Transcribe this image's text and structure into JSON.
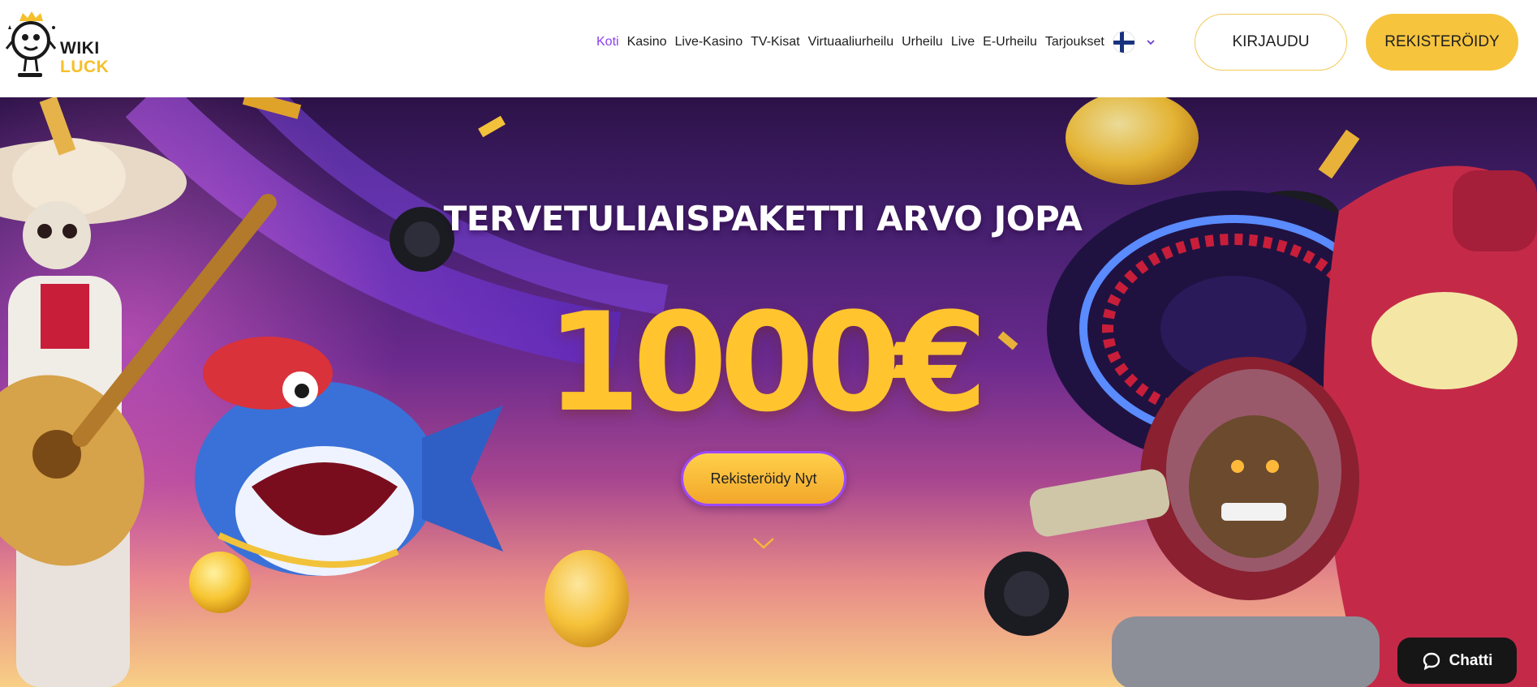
{
  "logo": {
    "line1": "WIKI",
    "line2": "LUCK"
  },
  "nav": {
    "items": [
      {
        "label": "Koti",
        "active": true
      },
      {
        "label": "Kasino"
      },
      {
        "label": "Live-Kasino"
      },
      {
        "label": "TV-Kisat"
      },
      {
        "label": "Virtuaaliurheilu"
      },
      {
        "label": "Urheilu"
      },
      {
        "label": "Live"
      },
      {
        "label": "E-Urheilu"
      },
      {
        "label": "Tarjoukset"
      }
    ]
  },
  "language": {
    "flag": "finland-flag-icon"
  },
  "auth": {
    "login_label": "KIRJAUDU",
    "register_label": "REKISTERÖIDY"
  },
  "hero": {
    "title": "TERVETULIAISPAKETTI ARVO JOPA",
    "amount": "1000€",
    "cta_label": "Rekisteröidy Nyt"
  },
  "chat": {
    "label": "Chatti"
  },
  "colors": {
    "accent_purple": "#8a3ff2",
    "brand_yellow": "#f6c43d",
    "amount_yellow": "#ffc42e",
    "chat_bg": "#161616"
  }
}
